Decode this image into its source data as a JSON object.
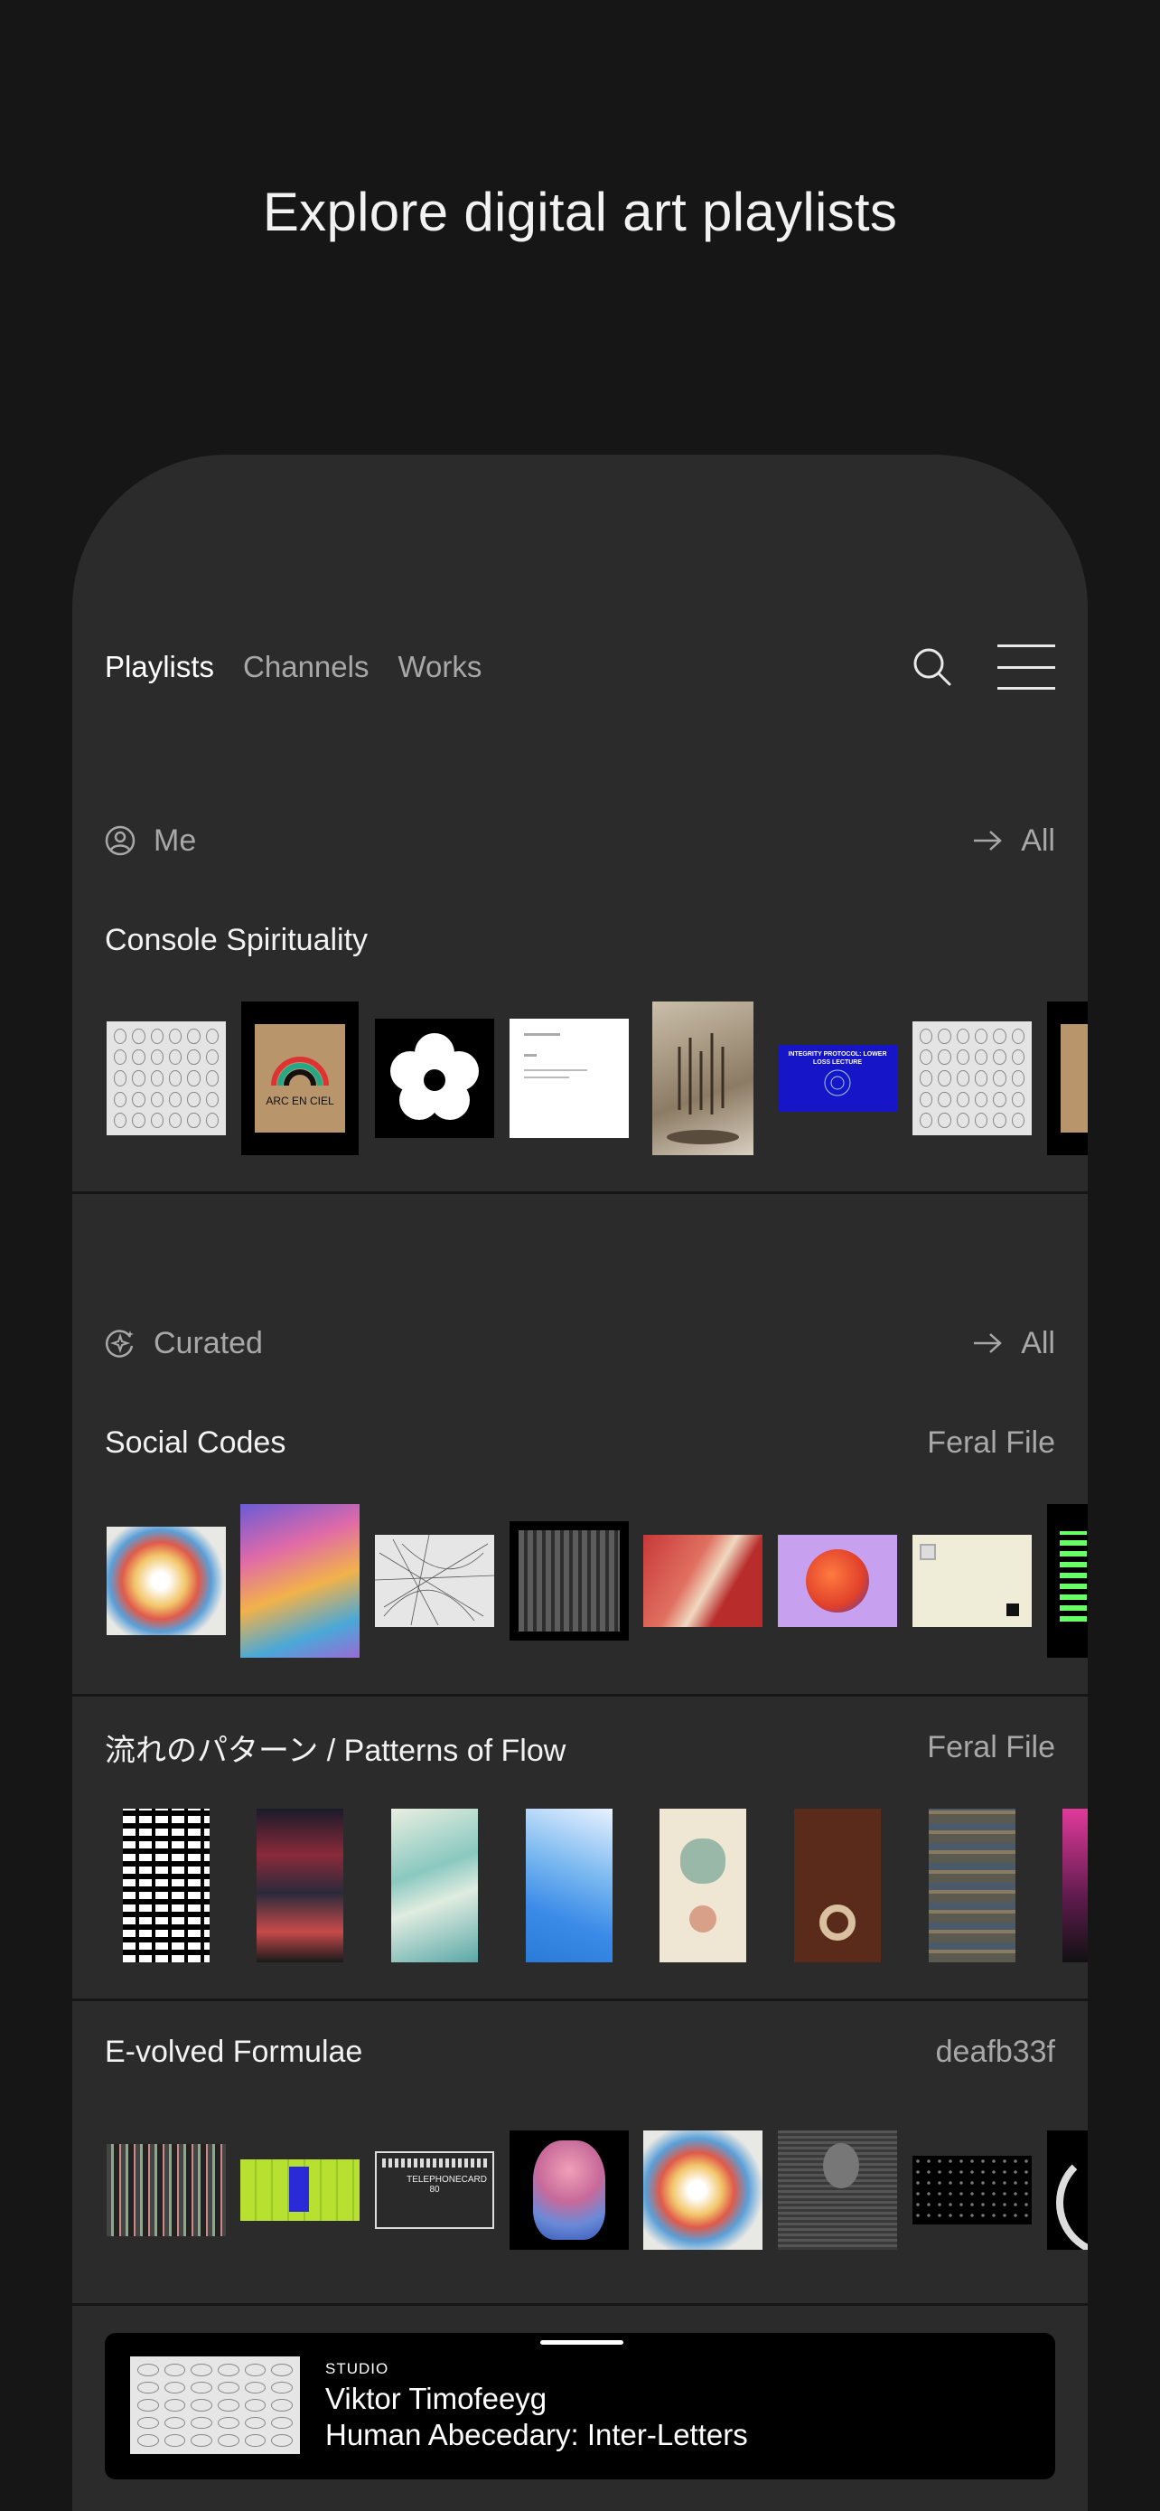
{
  "hero": {
    "title": "Explore digital art playlists"
  },
  "nav": {
    "tabs": [
      {
        "label": "Playlists",
        "active": true
      },
      {
        "label": "Channels",
        "active": false
      },
      {
        "label": "Works",
        "active": false
      }
    ],
    "icons": [
      "search-icon",
      "menu-icon"
    ]
  },
  "sections": {
    "me": {
      "label": "Me",
      "icon": "user-circle-icon",
      "all_label": "All",
      "playlists": [
        {
          "title": "Console Spirituality",
          "owner": ""
        }
      ]
    },
    "curated": {
      "label": "Curated",
      "icon": "sparkle-badge-icon",
      "all_label": "All",
      "playlists": [
        {
          "title": "Social Codes",
          "owner": "Feral File"
        },
        {
          "title": "流れのパターン / Patterns of Flow",
          "owner": "Feral File"
        },
        {
          "title": "E-volved Formulae",
          "owner": "deafb33f"
        }
      ]
    }
  },
  "artwork_texts": {
    "arc_en_ciel": "ARC EN CIEL",
    "integrity": "INTEGRITY PROTOCOL: LOWER LOSS LECTURE",
    "telephone": "TELEPHONECARD",
    "telephone_num": "80"
  },
  "now_playing": {
    "label": "STUDIO",
    "artist": "Viktor Timofeeyg",
    "work": "Human Abecedary: Inter-Letters"
  },
  "colors": {
    "background": "#161616",
    "panel": "#2b2b2b",
    "text_muted": "#a8a8a8"
  }
}
